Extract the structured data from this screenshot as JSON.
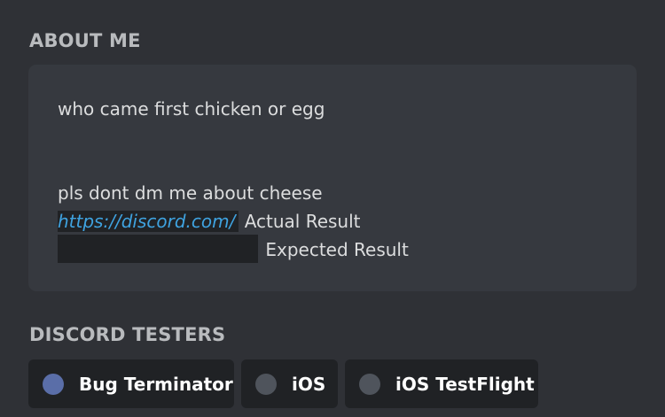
{
  "about_me": {
    "heading": "ABOUT ME",
    "line1": "who came first chicken or egg",
    "line2": "pls dont dm me about cheese",
    "link": "https://discord.com/",
    "actual_result_label": "Actual Result",
    "expected_result_label": "Expected Result"
  },
  "testers": {
    "heading": "DISCORD TESTERS",
    "roles": [
      {
        "label": "Bug Terminator",
        "color": "#5a6ea8"
      },
      {
        "label": "iOS",
        "color": "#4f545c"
      },
      {
        "label": "iOS TestFlight",
        "color": "#4f545c"
      }
    ]
  },
  "colors": {
    "background": "#2f3136",
    "card": "#36393f",
    "chip": "#202225",
    "link": "#3fa3e0",
    "heading": "#b9bbbe",
    "text": "#dcddde"
  }
}
